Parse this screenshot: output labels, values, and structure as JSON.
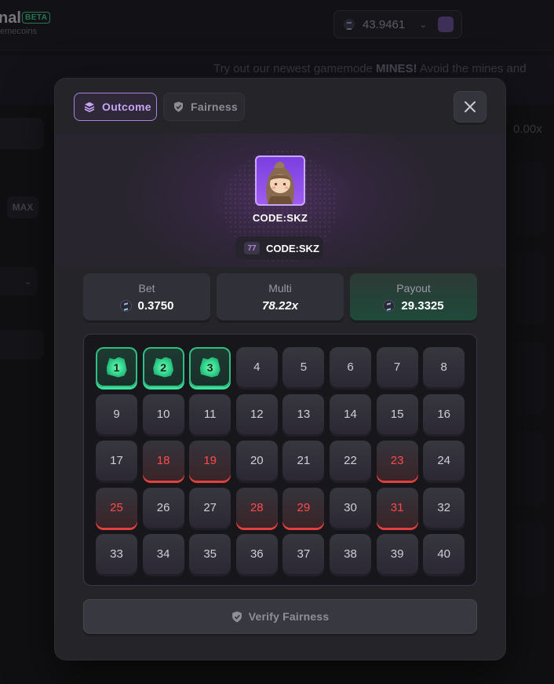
{
  "app": {
    "brand_fragment": "nal",
    "beta_badge": "BETA",
    "sub_fragment": "emecoins",
    "balance": "43.9461",
    "banner_prefix": "Try out our newest gamemode ",
    "banner_bold": "MINES!",
    "banner_suffix": " Avoid the mines and",
    "max_label": "MAX",
    "multi_readout": "0.00x"
  },
  "modal": {
    "tabs": [
      {
        "label": "Outcome",
        "active": true
      },
      {
        "label": "Fairness",
        "active": false
      }
    ],
    "player": {
      "name": "CODE:SKZ",
      "level": "77",
      "tag": "CODE:SKZ"
    },
    "stats": {
      "bet_label": "Bet",
      "bet_value": "0.3750",
      "multi_label": "Multi",
      "multi_value": "78.22x",
      "payout_label": "Payout",
      "payout_value": "29.3325"
    },
    "board": {
      "tiles": [
        {
          "n": "1",
          "state": "hit"
        },
        {
          "n": "2",
          "state": "hit"
        },
        {
          "n": "3",
          "state": "hit"
        },
        {
          "n": "4",
          "state": "none"
        },
        {
          "n": "5",
          "state": "none"
        },
        {
          "n": "6",
          "state": "none"
        },
        {
          "n": "7",
          "state": "none"
        },
        {
          "n": "8",
          "state": "none"
        },
        {
          "n": "9",
          "state": "none"
        },
        {
          "n": "10",
          "state": "none"
        },
        {
          "n": "11",
          "state": "none"
        },
        {
          "n": "12",
          "state": "none"
        },
        {
          "n": "13",
          "state": "none"
        },
        {
          "n": "14",
          "state": "none"
        },
        {
          "n": "15",
          "state": "none"
        },
        {
          "n": "16",
          "state": "none"
        },
        {
          "n": "17",
          "state": "none"
        },
        {
          "n": "18",
          "state": "miss"
        },
        {
          "n": "19",
          "state": "miss"
        },
        {
          "n": "20",
          "state": "none"
        },
        {
          "n": "21",
          "state": "none"
        },
        {
          "n": "22",
          "state": "none"
        },
        {
          "n": "23",
          "state": "miss"
        },
        {
          "n": "24",
          "state": "none"
        },
        {
          "n": "25",
          "state": "miss"
        },
        {
          "n": "26",
          "state": "none"
        },
        {
          "n": "27",
          "state": "none"
        },
        {
          "n": "28",
          "state": "miss"
        },
        {
          "n": "29",
          "state": "miss"
        },
        {
          "n": "30",
          "state": "none"
        },
        {
          "n": "31",
          "state": "miss"
        },
        {
          "n": "32",
          "state": "none"
        },
        {
          "n": "33",
          "state": "none"
        },
        {
          "n": "34",
          "state": "none"
        },
        {
          "n": "35",
          "state": "none"
        },
        {
          "n": "36",
          "state": "none"
        },
        {
          "n": "37",
          "state": "none"
        },
        {
          "n": "38",
          "state": "none"
        },
        {
          "n": "39",
          "state": "none"
        },
        {
          "n": "40",
          "state": "none"
        }
      ]
    },
    "verify_label": "Verify Fairness"
  },
  "colors": {
    "accent": "#a883e0",
    "hit": "#3ae29a",
    "miss": "#ff4b4b"
  }
}
